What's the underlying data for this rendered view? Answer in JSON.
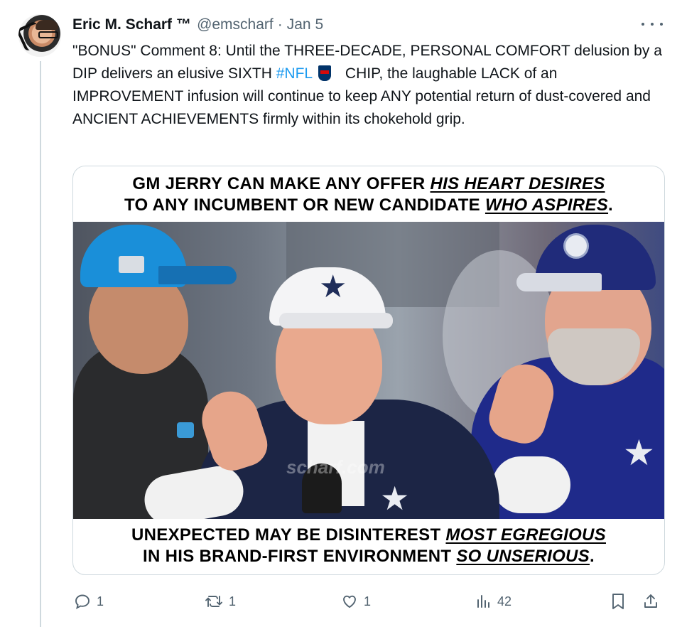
{
  "tweet": {
    "author_name": "Eric M. Scharf",
    "trademark": "™",
    "handle": "@emscharf",
    "separator": "·",
    "date": "Jan 5",
    "text_part1": "\"BONUS\" Comment 8: Until the THREE-DECADE, PERSONAL COMFORT delusion by a DIP delivers an elusive SIXTH ",
    "hashtag": "#NFL",
    "text_part2": " CHIP, the laughable LACK of an IMPROVEMENT infusion will continue to keep ANY potential return of dust-covered and ANCIENT ACHIEVEMENTS firmly within its chokehold grip."
  },
  "media": {
    "top_caption": {
      "line1_plain": "GM JERRY CAN MAKE ANY OFFER ",
      "line1_em": "HIS HEART DESIRES",
      "line2_plain": "TO ANY INCUMBENT OR NEW CANDIDATE ",
      "line2_em": "WHO ASPIRES",
      "line2_end": "."
    },
    "bottom_caption": {
      "line1_plain": "UNEXPECTED MAY BE DISINTEREST ",
      "line1_em": "MOST EGREGIOUS",
      "line2_plain": "IN HIS BRAND-FIRST ENVIRONMENT ",
      "line2_em": "SO UNSERIOUS",
      "line2_end": "."
    },
    "watermark": "scharf.com"
  },
  "actions": {
    "replies": "1",
    "reposts": "1",
    "likes": "1",
    "views": "42"
  },
  "icons": {
    "reply": "reply-icon",
    "repost": "repost-icon",
    "like": "heart-icon",
    "views": "views-icon",
    "bookmark": "bookmark-icon",
    "share": "share-icon",
    "more": "more-icon"
  },
  "colors": {
    "link": "#1d9bf0",
    "muted": "#536471",
    "text": "#0f1419",
    "border": "#cfd9de"
  }
}
